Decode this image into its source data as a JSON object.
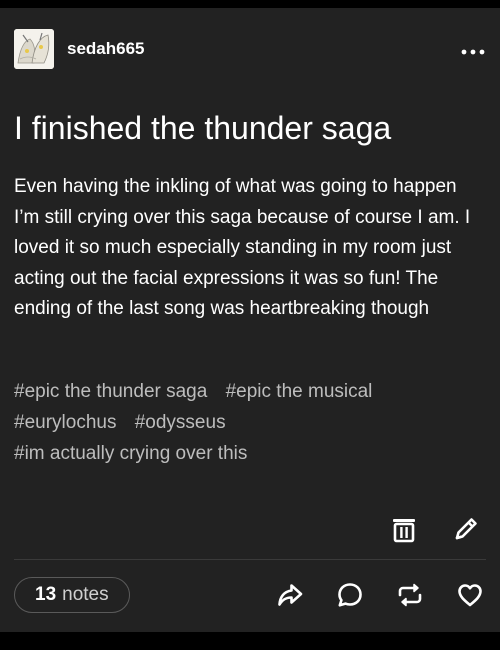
{
  "post": {
    "author": "sedah665",
    "title": "I finished the thunder saga",
    "body": "Even having the inkling of what was going to happen I’m still crying over this saga because of course I am. I loved it so much especially standing in my room just acting out the facial expressions it was so fun! The ending of the last song was heartbreaking though",
    "tags": [
      "#epic the thunder saga",
      "#epic the musical",
      "#eurylochus",
      "#odysseus",
      "#im actually crying over this"
    ],
    "notes": {
      "count": "13",
      "label": "notes"
    }
  },
  "icons": {
    "more": "more-dots-icon",
    "delete": "trash-icon",
    "edit": "pencil-icon",
    "share": "share-icon",
    "reply": "reply-bubble-icon",
    "reblog": "reblog-icon",
    "like": "heart-icon"
  },
  "colors": {
    "background": "#000000",
    "card": "#222222",
    "text": "#ffffff",
    "tag": "#bdbdbd",
    "pill_border": "#5a5a5a"
  }
}
